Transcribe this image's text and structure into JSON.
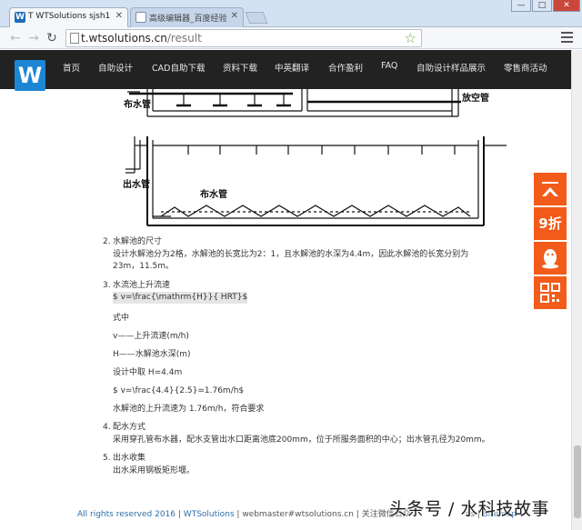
{
  "browser": {
    "tabs": [
      {
        "title": "T WTSolutions sjsh1",
        "active": true
      },
      {
        "title": "高级编辑器_百度经验",
        "active": false
      }
    ],
    "url_host": "t.wtsolutions.cn",
    "url_path": "/result",
    "window_controls": [
      "minimize",
      "maximize",
      "close"
    ]
  },
  "site": {
    "logo": "W",
    "nav": [
      "首页",
      "自助设计",
      "CAD自助下载",
      "资料下载",
      "中英翻译",
      "合作盈利",
      "FAQ",
      "自助设计样品展示",
      "零售商活动"
    ]
  },
  "diagram": {
    "labels": {
      "inlet_top": "布水管",
      "drain": "放空管",
      "outlet": "出水管",
      "inlet_bottom": "布水管"
    }
  },
  "sections": [
    {
      "num": "2.",
      "title": "水解池的尺寸",
      "lines": [
        "设计水解池分为2格，水解池的长宽比为2：1，且水解池的水深为4.4m，因此水解池的长宽分别为",
        "23m，11.5m。"
      ]
    },
    {
      "num": "3.",
      "title": "水流池上升流速",
      "lines": [
        "$ v=\\frac{\\mathrm{H}}{ HRT}$",
        "式中",
        "v——上升流速(m/h)",
        "H——水解池水深(m)",
        "设计中取 H=4.4m",
        "$ v=\\frac{4.4}{2.5}=1.76m/h$",
        "水解池的上升流速为 1.76m/h，符合要求"
      ]
    },
    {
      "num": "4.",
      "title": "配水方式",
      "lines": [
        "采用穿孔管布水器，配水支管出水口距离池底200mm，位于所服务面积的中心；出水管孔径为20mm。"
      ]
    },
    {
      "num": "5.",
      "title": "出水收集",
      "lines": [
        "出水采用钢板矩形堰。"
      ]
    }
  ],
  "side_buttons": {
    "top_label": "",
    "discount_label": "9折"
  },
  "footer": {
    "copyright": "All rights reserved 2016",
    "sep1": " | ",
    "brand": "WTSolutions",
    "sep2": " | ",
    "email": "webmaster#wtsolutions.cn",
    "sep3": " | ",
    "wechat": "关注微信公众",
    "tail": "ns | ",
    "sitemap": "Sitemap"
  },
  "watermark": "头条号 / 水科技故事"
}
